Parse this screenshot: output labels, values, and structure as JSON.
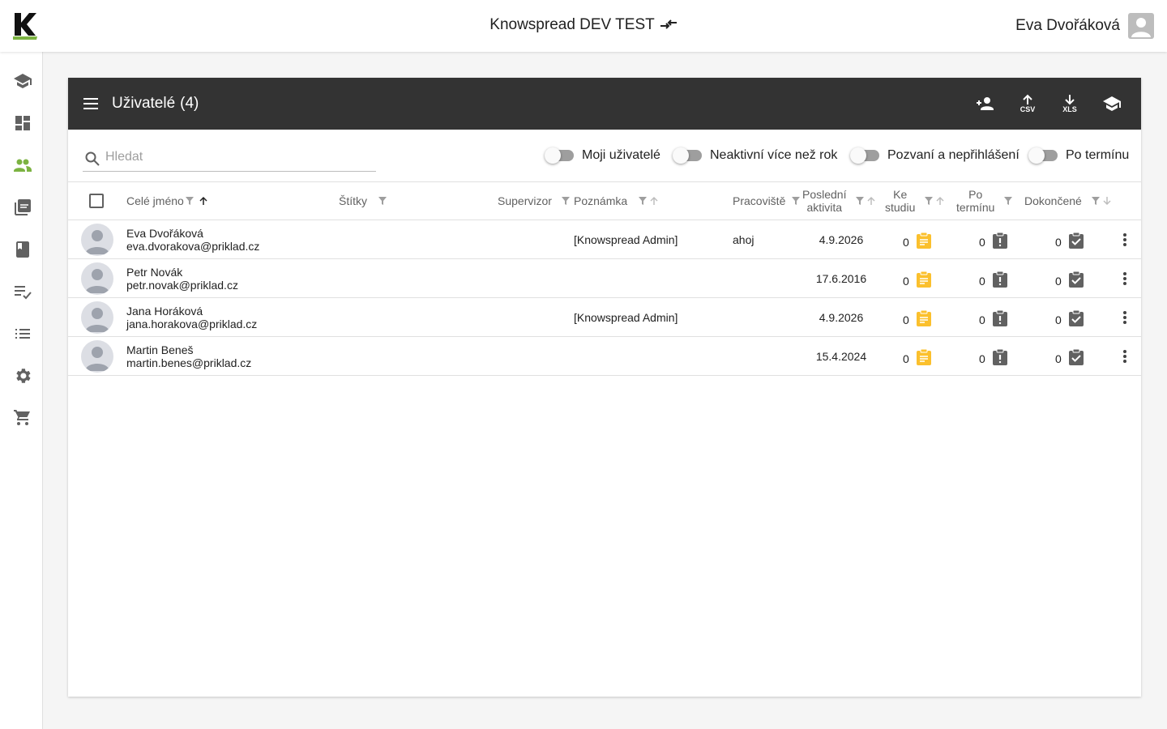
{
  "topbar": {
    "app_title": "Knowspread DEV TEST",
    "user_name": "Eva Dvořáková"
  },
  "sidebar": {
    "items": [
      {
        "icon": "school-icon"
      },
      {
        "icon": "dashboard-icon"
      },
      {
        "icon": "people-icon",
        "active": true
      },
      {
        "icon": "library-icon"
      },
      {
        "icon": "book-icon"
      },
      {
        "icon": "playlist-check-icon"
      },
      {
        "icon": "list-icon"
      },
      {
        "icon": "settings-icon"
      },
      {
        "icon": "cart-icon"
      }
    ]
  },
  "card": {
    "title": "Uživatelé",
    "count": "(4)",
    "actions": {
      "add_user": "add-user-icon",
      "csv_label": "CSV",
      "xls_label": "XLS",
      "assign": "school-icon"
    }
  },
  "filters": {
    "search_placeholder": "Hledat",
    "toggles": [
      {
        "label": "Moji uživatelé",
        "on": false
      },
      {
        "label": "Neaktivní více než rok",
        "on": false
      },
      {
        "label": "Pozvaní a nepřihlášení",
        "on": false
      },
      {
        "label": "Po termínu",
        "on": false
      }
    ]
  },
  "table": {
    "columns": {
      "name": "Celé jméno",
      "tags": "Štítky",
      "supervisor": "Supervizor",
      "note": "Poznámka",
      "workplace": "Pracoviště",
      "last_activity": [
        "Poslední",
        "aktivita"
      ],
      "to_study": [
        "Ke",
        "studiu"
      ],
      "overdue": [
        "Po",
        "termínu"
      ],
      "completed": "Dokončené"
    },
    "rows": [
      {
        "name": "Eva Dvořáková",
        "email": "eva.dvorakova@priklad.cz",
        "note": "[Knowspread Admin]",
        "workplace": "ahoj",
        "last_activity": "4.9.2026",
        "to_study": "0",
        "overdue": "0",
        "completed": "0"
      },
      {
        "name": "Petr Novák",
        "email": "petr.novak@priklad.cz",
        "note": "",
        "workplace": "",
        "last_activity": "17.6.2016",
        "to_study": "0",
        "overdue": "0",
        "completed": "0"
      },
      {
        "name": "Jana Horáková",
        "email": "jana.horakova@priklad.cz",
        "note": "[Knowspread Admin]",
        "workplace": "",
        "last_activity": "4.9.2026",
        "to_study": "0",
        "overdue": "0",
        "completed": "0"
      },
      {
        "name": "Martin Beneš",
        "email": "martin.benes@priklad.cz",
        "note": "",
        "workplace": "",
        "last_activity": "15.4.2024",
        "to_study": "0",
        "overdue": "0",
        "completed": "0"
      }
    ]
  },
  "colors": {
    "header_bg": "#333333",
    "accent_green": "#7cb342",
    "to_study_icon": "#fbc02d",
    "status_icon": "#616161"
  }
}
